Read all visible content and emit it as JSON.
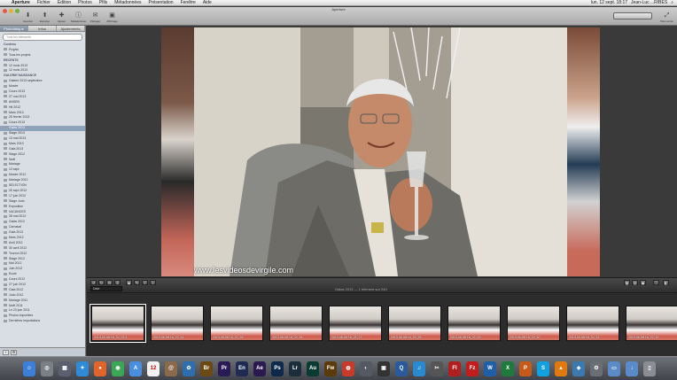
{
  "menubar": {
    "apple": "",
    "items": [
      "Aperture",
      "Fichier",
      "Édition",
      "Photos",
      "Pfils",
      "Métadonnées",
      "Présentation",
      "Fenêtre",
      "Aide"
    ],
    "clock": "lun. 12 sept. 18:17",
    "user": "Jean-Luc ...RIBES"
  },
  "window": {
    "title": "Aperture"
  },
  "toolbar": {
    "buttons": [
      "Importer",
      "Exporter",
      "Ajuster",
      "Métadonnées",
      "Partager",
      "Affichage"
    ],
    "right_label": "Plein écran"
  },
  "sidebar": {
    "tabs": [
      "Photothèque",
      "Infos",
      "Ajustements"
    ],
    "search_placeholder": "Tous les éléments",
    "items": [
      {
        "label": "Contenu",
        "head": true
      },
      {
        "label": "Projets"
      },
      {
        "label": "Tous les projets"
      },
      {
        "label": "RÉCENTS",
        "head": true
      },
      {
        "label": "12 mois 2013"
      },
      {
        "label": "12 mois 2013"
      },
      {
        "label": "GALERIE NAISSANCE",
        "head": true
      },
      {
        "label": "Galerie 2013 septembre"
      },
      {
        "label": "Musée"
      },
      {
        "label": "Cours 2013"
      },
      {
        "label": "27 mai 2013"
      },
      {
        "label": "ANSEN"
      },
      {
        "label": "Hit 2012"
      },
      {
        "label": "Mars 2013"
      },
      {
        "label": "25 février 2013"
      },
      {
        "label": "Cours 2013"
      },
      {
        "label": "Galas 2013",
        "selected": true
      },
      {
        "label": "Stage 2013"
      },
      {
        "label": "13 mai 2013"
      },
      {
        "label": "Mars 2013"
      },
      {
        "label": "Gala 2013"
      },
      {
        "label": "Stage 2012"
      },
      {
        "label": "Noël"
      },
      {
        "label": "Mariage"
      },
      {
        "label": "13 sept"
      },
      {
        "label": "Musée 2012"
      },
      {
        "label": "Mariage 2012"
      },
      {
        "label": "SÉLECTION"
      },
      {
        "label": "30 sept 2012"
      },
      {
        "label": "17 juin 2012"
      },
      {
        "label": "Stage Judo"
      },
      {
        "label": "Exposition"
      },
      {
        "label": "VACANCES"
      },
      {
        "label": "28 mai 2012"
      },
      {
        "label": "Galas 2012"
      },
      {
        "label": "Carnaval"
      },
      {
        "label": "Gala 2012"
      },
      {
        "label": "Mars 2012"
      },
      {
        "label": "Avril 2012"
      },
      {
        "label": "30 avril 2012"
      },
      {
        "label": "Tournoi 2012"
      },
      {
        "label": "Stage 2012"
      },
      {
        "label": "Mai 2012"
      },
      {
        "label": "Juin 2012"
      },
      {
        "label": "Ecole"
      },
      {
        "label": "Cours 2012"
      },
      {
        "label": "27 juin 2012"
      },
      {
        "label": "Gala 2012"
      },
      {
        "label": "Judo 2012"
      },
      {
        "label": "Mariage 2011"
      },
      {
        "label": "Noël 2011"
      },
      {
        "label": "Le 23 juin 2011"
      },
      {
        "label": "Photos importées"
      },
      {
        "label": "Dernières importations"
      }
    ]
  },
  "viewer": {
    "watermark": "www.lesvideosdevirgile.com",
    "status": "Galas 2013 — 1 élément sur 240",
    "sort_label": "Date"
  },
  "filmstrip": {
    "thumbs": [
      {
        "caption": "2013-06-08 16_22_23-1",
        "selected": true
      },
      {
        "caption": "2013-06-08 16_22_24"
      },
      {
        "caption": "2013-06-08 16_22_25"
      },
      {
        "caption": "2013-06-08 16_22_26"
      },
      {
        "caption": "2013-06-08 16_22_27"
      },
      {
        "caption": "2013-06-08 16_22_28"
      },
      {
        "caption": "2013-06-08 16_22_29"
      },
      {
        "caption": "2013-06-08 16_22_30"
      },
      {
        "caption": "2013-06-08 16_22_31"
      },
      {
        "caption": "2013-06-08 16_22_32"
      }
    ]
  },
  "dock": {
    "apps": [
      {
        "name": "finder",
        "glyph": "☺",
        "color": "#3d7fd6"
      },
      {
        "name": "launchpad",
        "glyph": "◎",
        "color": "#7a7f88"
      },
      {
        "name": "mission-control",
        "glyph": "▦",
        "color": "#5a6070"
      },
      {
        "name": "safari",
        "glyph": "✦",
        "color": "#2f8ad8"
      },
      {
        "name": "firefox",
        "glyph": "●",
        "color": "#e0652a"
      },
      {
        "name": "chrome",
        "glyph": "◉",
        "color": "#3aa757"
      },
      {
        "name": "app-store",
        "glyph": "A",
        "color": "#4a8ee0"
      },
      {
        "name": "calendar",
        "glyph": "12",
        "color": "#f2f2f2"
      },
      {
        "name": "contacts",
        "glyph": "@",
        "color": "#8a6a4a"
      },
      {
        "name": "photo-app",
        "glyph": "✿",
        "color": "#2d6db0"
      },
      {
        "name": "bridge",
        "glyph": "Br",
        "color": "#6a4a12"
      },
      {
        "name": "premiere",
        "glyph": "Pr",
        "color": "#2b1b55"
      },
      {
        "name": "encore",
        "glyph": "En",
        "color": "#1f2a55"
      },
      {
        "name": "after-effects",
        "glyph": "Ae",
        "color": "#2a1a4f"
      },
      {
        "name": "photoshop",
        "glyph": "Ps",
        "color": "#0d2a4a"
      },
      {
        "name": "lightroom",
        "glyph": "Lr",
        "color": "#1b2f3b"
      },
      {
        "name": "audition",
        "glyph": "Au",
        "color": "#0b3a33"
      },
      {
        "name": "fireworks",
        "glyph": "Fw",
        "color": "#5a3a0a"
      },
      {
        "name": "toast",
        "glyph": "◍",
        "color": "#c83a2a"
      },
      {
        "name": "disk-utility",
        "glyph": "◐",
        "color": "#555a62"
      },
      {
        "name": "dvd-player",
        "glyph": "▣",
        "color": "#333"
      },
      {
        "name": "quicktime",
        "glyph": "Q",
        "color": "#2a5a9a"
      },
      {
        "name": "itunes",
        "glyph": "♫",
        "color": "#2a8ad0"
      },
      {
        "name": "movie",
        "glyph": "✂",
        "color": "#555"
      },
      {
        "name": "flash",
        "glyph": "Fl",
        "color": "#b01e1e"
      },
      {
        "name": "filezilla",
        "glyph": "Fz",
        "color": "#c21c1c"
      },
      {
        "name": "word",
        "glyph": "W",
        "color": "#1f5fa8"
      },
      {
        "name": "excel",
        "glyph": "X",
        "color": "#1e7a3a"
      },
      {
        "name": "powerpoint",
        "glyph": "P",
        "color": "#c55a1a"
      },
      {
        "name": "skype",
        "glyph": "S",
        "color": "#11a0e0"
      },
      {
        "name": "vlc",
        "glyph": "▲",
        "color": "#e07a10"
      },
      {
        "name": "preview",
        "glyph": "◈",
        "color": "#3a7ab0"
      },
      {
        "name": "system-preferences",
        "glyph": "⚙",
        "color": "#6a6e75"
      },
      {
        "name": "documents-folder",
        "glyph": "▭",
        "color": "#5a8ac8"
      },
      {
        "name": "downloads-folder",
        "glyph": "↓",
        "color": "#5a8ac8"
      },
      {
        "name": "trash",
        "glyph": "▯",
        "color": "#8a8e94"
      }
    ]
  }
}
